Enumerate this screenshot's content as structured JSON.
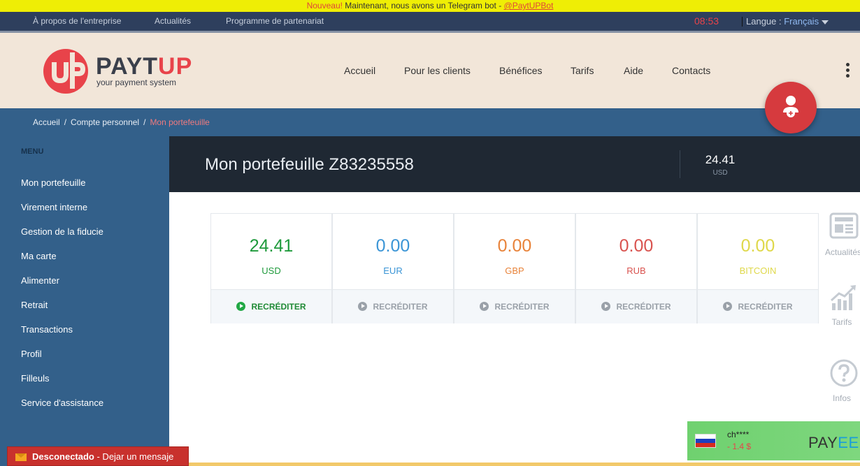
{
  "announcement": {
    "badge": "Nouveau!",
    "text": " Maintenant, nous avons un Telegram bot - ",
    "link": "@PaytUPBot"
  },
  "topnav": {
    "links": [
      "À propos de l'entreprise",
      "Actualités",
      "Programme de partenariat"
    ],
    "clock": "08:53",
    "language_label": "Langue : ",
    "language_value": "Français"
  },
  "logo": {
    "brand_main": "PAYT",
    "brand_accent": "UP",
    "tagline": "your payment system",
    "colors": {
      "red": "#e8434a",
      "dark": "#3a3f4b"
    }
  },
  "mainnav": [
    "Accueil",
    "Pour les clients",
    "Bénéfices",
    "Tarifs",
    "Aide",
    "Contacts"
  ],
  "breadcrumb": {
    "items": [
      "Accueil",
      "Compte personnel"
    ],
    "current": "Mon portefeuille",
    "separator": "/"
  },
  "sidebar": {
    "title": "MENU",
    "items": [
      "Mon portefeuille",
      "Virement interne",
      "Gestion de la fiducie",
      "Ma carte",
      "Alimenter",
      "Retrait",
      "Transactions",
      "Profil",
      "Filleuls",
      "Service d'assistance"
    ]
  },
  "wallet": {
    "title": "Mon portefeuille Z83235558",
    "balance": "24.41",
    "balance_currency": "USD"
  },
  "currencies": [
    {
      "amount": "24.41",
      "code": "USD",
      "action": "RECRÉDITER",
      "color": "#1f9a3c",
      "active": true
    },
    {
      "amount": "0.00",
      "code": "EUR",
      "action": "RECRÉDITER",
      "color": "#3b95d6",
      "active": false
    },
    {
      "amount": "0.00",
      "code": "GBP",
      "action": "RECRÉDITER",
      "color": "#e8833a",
      "active": false
    },
    {
      "amount": "0.00",
      "code": "RUB",
      "action": "RECRÉDITER",
      "color": "#d9534f",
      "active": false
    },
    {
      "amount": "0.00",
      "code": "BITCOIN",
      "action": "RECRÉDITER",
      "color": "#dfd84a",
      "active": false
    }
  ],
  "side_widgets": [
    {
      "icon": "news-icon",
      "label": "Actualités"
    },
    {
      "icon": "chart-icon",
      "label": "Tarifs"
    },
    {
      "icon": "question-icon",
      "label": "Infos"
    }
  ],
  "payee": {
    "user": "ch****",
    "amount": "- 1.4 $",
    "logo_main": "PAY",
    "logo_accent": "EE",
    "flag": "russia-flag-icon"
  },
  "chat": {
    "status": "Desconectado",
    "message": " - Dejar un mensaje"
  }
}
